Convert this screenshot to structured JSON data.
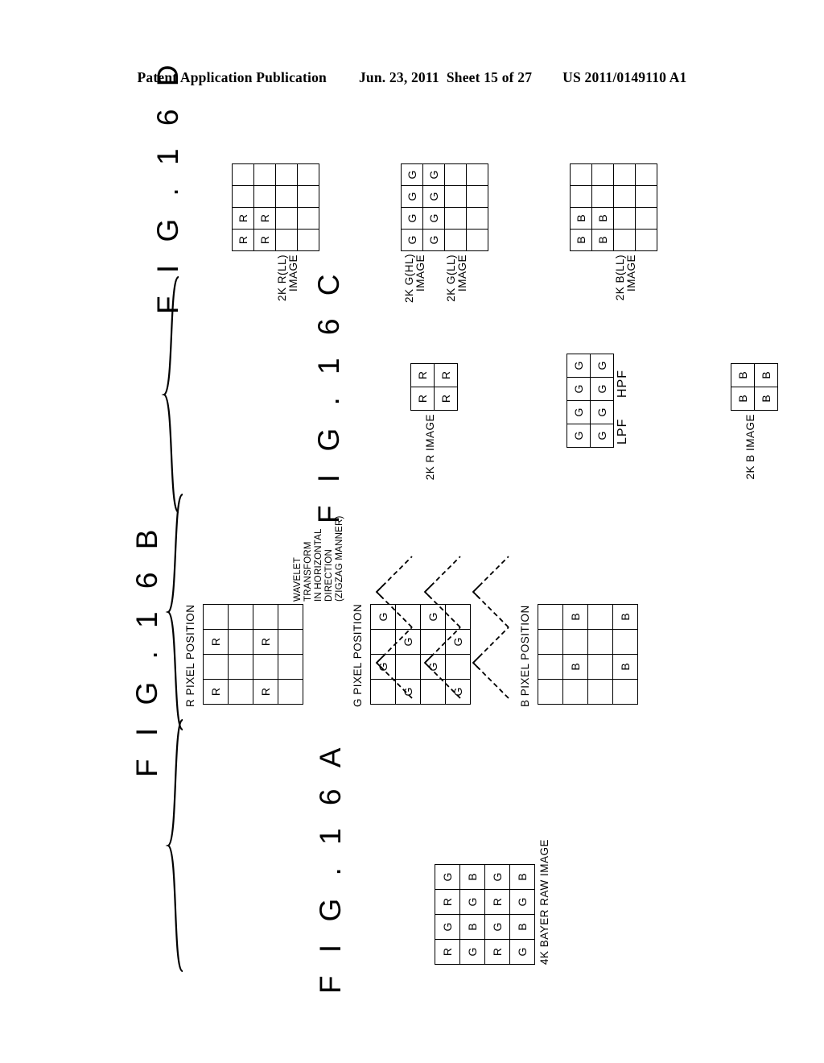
{
  "header": {
    "publication": "Patent Application Publication",
    "date": "Jun. 23, 2011",
    "sheet": "Sheet 15 of 27",
    "docnum": "US 2011/0149110 A1"
  },
  "figures": {
    "a": {
      "title": "F I G . 1 6 A",
      "caption": "4K BAYER RAW IMAGE",
      "grid": {
        "rows": 4,
        "cols": 4,
        "cells": [
          [
            "R",
            "G",
            "R",
            "G"
          ],
          [
            "G",
            "B",
            "G",
            "B"
          ],
          [
            "R",
            "G",
            "R",
            "G"
          ],
          [
            "G",
            "B",
            "G",
            "B"
          ]
        ]
      }
    },
    "b": {
      "title": "F I G . 1 6 B",
      "annotation": "WAVELET\nTRANSFORM\nIN HORIZONTAL\nDIRECTION\n(ZIGZAG MANNER)",
      "panels": [
        {
          "label": "R PIXEL POSITION",
          "rows": 4,
          "cols": 4,
          "cells": [
            [
              "R",
              "",
              "R",
              ""
            ],
            [
              "",
              "",
              "",
              ""
            ],
            [
              "R",
              "",
              "R",
              ""
            ],
            [
              "",
              "",
              "",
              ""
            ]
          ]
        },
        {
          "label": "G PIXEL POSITION",
          "rows": 4,
          "cols": 4,
          "cells": [
            [
              "",
              "G",
              "",
              "G"
            ],
            [
              "G",
              "",
              "G",
              ""
            ],
            [
              "",
              "G",
              "",
              "G"
            ],
            [
              "G",
              "",
              "G",
              ""
            ]
          ]
        },
        {
          "label": "B PIXEL POSITION",
          "rows": 4,
          "cols": 4,
          "cells": [
            [
              "",
              "",
              "",
              ""
            ],
            [
              "",
              "B",
              "",
              "B"
            ],
            [
              "",
              "",
              "",
              ""
            ],
            [
              "",
              "B",
              "",
              "B"
            ]
          ]
        }
      ]
    },
    "c": {
      "title": "F I G . 1 6 C",
      "panels": [
        {
          "label": "2K R IMAGE",
          "rows": 2,
          "cols": 2,
          "cells": [
            [
              "R",
              "R"
            ],
            [
              "R",
              "R"
            ]
          ]
        },
        {
          "label": "",
          "sub_labels": {
            "lpf": "LPF",
            "hpf": "HPF"
          },
          "rows": 2,
          "cols": 4,
          "cells": [
            [
              "G",
              "G",
              "G",
              "G"
            ],
            [
              "G",
              "G",
              "G",
              "G"
            ]
          ],
          "hpf_cols": [
            2,
            3
          ]
        },
        {
          "label": "2K B IMAGE",
          "rows": 2,
          "cols": 2,
          "cells": [
            [
              "B",
              "B"
            ],
            [
              "B",
              "B"
            ]
          ]
        }
      ]
    },
    "d": {
      "title": "F I G . 1 6 D",
      "panels": [
        {
          "label": "2K R(LL)\nIMAGE",
          "rows": 4,
          "cols": 4,
          "cells": [
            [
              "R",
              "R",
              "",
              ""
            ],
            [
              "R",
              "R",
              "",
              ""
            ],
            [
              "",
              "",
              "",
              ""
            ],
            [
              "",
              "",
              "",
              ""
            ]
          ]
        },
        {
          "label_ll": "2K G(LL)\nIMAGE",
          "label_hl": "2K G(HL)\nIMAGE",
          "rows": 4,
          "cols": 4,
          "cells": [
            [
              "G",
              "G",
              "G",
              "G"
            ],
            [
              "G",
              "G",
              "G",
              "G"
            ],
            [
              "",
              "",
              "",
              ""
            ],
            [
              "",
              "",
              "",
              ""
            ]
          ],
          "hl_cols": [
            2,
            3
          ]
        },
        {
          "label": "2K B(LL)\nIMAGE",
          "rows": 4,
          "cols": 4,
          "cells": [
            [
              "B",
              "B",
              "",
              ""
            ],
            [
              "B",
              "B",
              "",
              ""
            ],
            [
              "",
              "",
              "",
              ""
            ],
            [
              "",
              "",
              "",
              ""
            ]
          ]
        }
      ]
    }
  }
}
